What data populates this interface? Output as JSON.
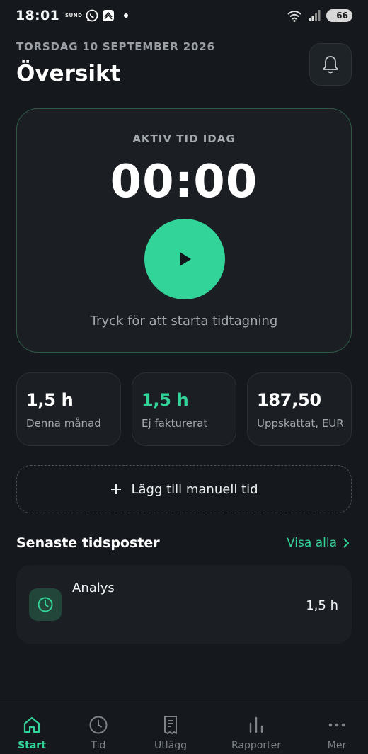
{
  "status_bar": {
    "time": "18:01",
    "carrier_badge": "SUND",
    "battery": "66"
  },
  "header": {
    "date": "TORSDAG 10 SEPTEMBER 2026",
    "title": "Översikt"
  },
  "timer": {
    "label": "AKTIV TID IDAG",
    "value": "00:00",
    "hint": "Tryck för att starta tidtagning"
  },
  "stats": [
    {
      "value": "1,5 h",
      "label": "Denna månad"
    },
    {
      "value": "1,5 h",
      "label": "Ej fakturerat"
    },
    {
      "value": "187,50",
      "label": "Uppskattat, EUR"
    }
  ],
  "manual": {
    "label": "Lägg till manuell tid"
  },
  "recent": {
    "title": "Senaste tidsposter",
    "see_all": "Visa alla",
    "entries": [
      {
        "name": "Analys",
        "hours": "1,5 h",
        "icon": "clock-icon"
      }
    ]
  },
  "nav": [
    {
      "label": "Start",
      "icon": "home-icon",
      "active": true
    },
    {
      "label": "Tid",
      "icon": "clock-icon"
    },
    {
      "label": "Utlägg",
      "icon": "receipt-icon"
    },
    {
      "label": "Rapporter",
      "icon": "bar-chart-icon"
    },
    {
      "label": "Mer",
      "icon": "more-icon"
    }
  ],
  "colors": {
    "accent": "#33d499",
    "background": "#15181c",
    "card": "#1b1f24"
  }
}
